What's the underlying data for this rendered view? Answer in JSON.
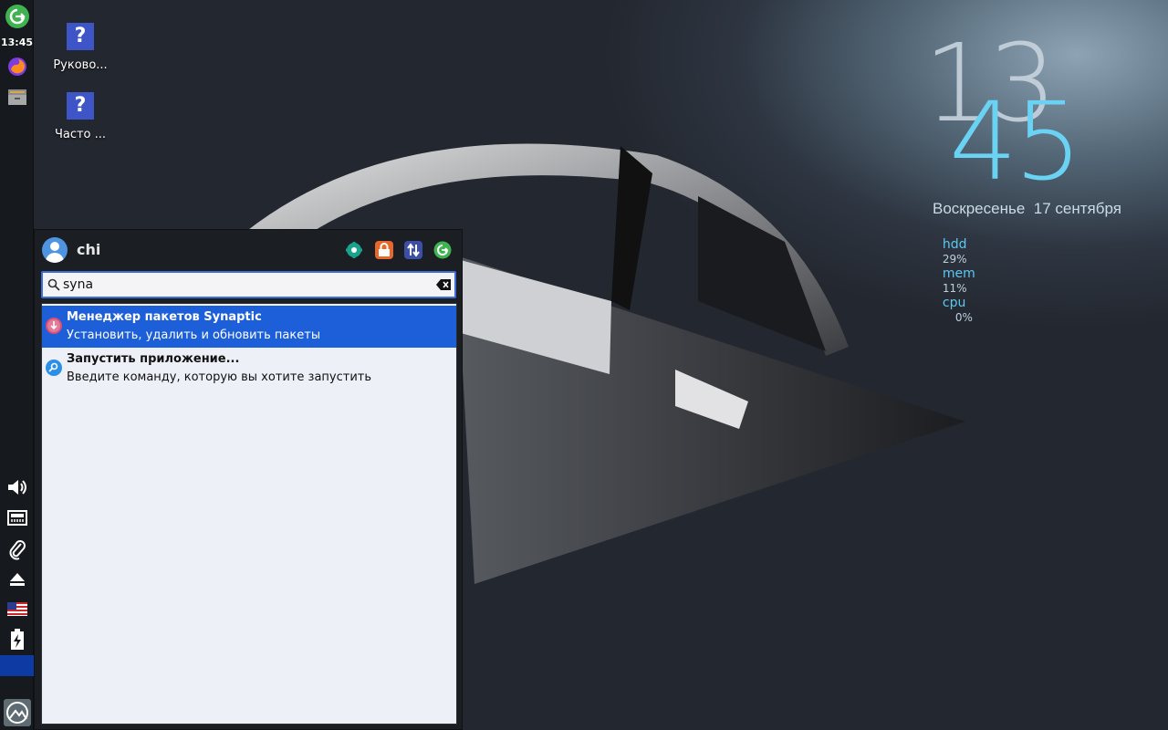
{
  "panel": {
    "time": "13:45",
    "icons": [
      "exit-icon",
      "firefox-icon",
      "file-manager-icon",
      "volume-icon",
      "network-icon",
      "clipboard-icon",
      "eject-icon",
      "us-flag-icon",
      "battery-icon",
      "app-menu-icon"
    ]
  },
  "desktop": {
    "icons": [
      {
        "glyph": "?",
        "label": "Руково..."
      },
      {
        "glyph": "?",
        "label": "Часто ..."
      }
    ]
  },
  "conky": {
    "hour": "13",
    "minute": "45",
    "date": "Воскресенье  17 сентября",
    "hdd_label": "hdd",
    "hdd_value": "29%",
    "mem_label": "mem",
    "mem_value": "11%",
    "cpu_label": "cpu",
    "cpu_value": "0%"
  },
  "menu": {
    "username": "chi",
    "search": {
      "value": "syna"
    },
    "header_buttons": [
      "settings-icon",
      "lock-icon",
      "switch-user-icon",
      "logout-icon"
    ],
    "results": [
      {
        "title": "Менеджер пакетов Synaptic",
        "subtitle": "Установить, удалить и обновить пакеты",
        "icon": "synaptic-icon",
        "selected": true
      },
      {
        "title": "Запустить приложение...",
        "subtitle": "Введите команду, которую вы хотите запустить",
        "icon": "run-icon",
        "selected": false
      }
    ]
  },
  "colors": {
    "selection": "#1c5fd8",
    "conky_accent": "#5ec8f0",
    "panel_active": "#0d3ba3"
  }
}
